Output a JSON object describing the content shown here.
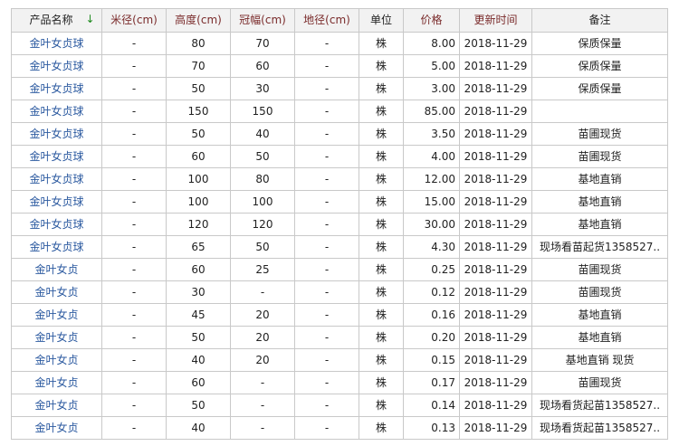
{
  "columns": {
    "name": "产品名称",
    "meter_diameter": "米径(cm)",
    "height": "高度(cm)",
    "crown": "冠幅(cm)",
    "ground_diameter": "地径(cm)",
    "unit": "单位",
    "price": "价格",
    "updated": "更新时间",
    "note": "备注"
  },
  "sort_icon": "down-arrow-icon",
  "rows": [
    {
      "name": "金叶女贞球",
      "meter_diameter": "-",
      "height": "80",
      "crown": "70",
      "ground_diameter": "-",
      "unit": "株",
      "price": "8.00",
      "updated": "2018-11-29",
      "note": "保质保量"
    },
    {
      "name": "金叶女贞球",
      "meter_diameter": "-",
      "height": "70",
      "crown": "60",
      "ground_diameter": "-",
      "unit": "株",
      "price": "5.00",
      "updated": "2018-11-29",
      "note": "保质保量"
    },
    {
      "name": "金叶女贞球",
      "meter_diameter": "-",
      "height": "50",
      "crown": "30",
      "ground_diameter": "-",
      "unit": "株",
      "price": "3.00",
      "updated": "2018-11-29",
      "note": "保质保量"
    },
    {
      "name": "金叶女贞球",
      "meter_diameter": "-",
      "height": "150",
      "crown": "150",
      "ground_diameter": "-",
      "unit": "株",
      "price": "85.00",
      "updated": "2018-11-29",
      "note": ""
    },
    {
      "name": "金叶女贞球",
      "meter_diameter": "-",
      "height": "50",
      "crown": "40",
      "ground_diameter": "-",
      "unit": "株",
      "price": "3.50",
      "updated": "2018-11-29",
      "note": "苗圃现货"
    },
    {
      "name": "金叶女贞球",
      "meter_diameter": "-",
      "height": "60",
      "crown": "50",
      "ground_diameter": "-",
      "unit": "株",
      "price": "4.00",
      "updated": "2018-11-29",
      "note": "苗圃现货"
    },
    {
      "name": "金叶女贞球",
      "meter_diameter": "-",
      "height": "100",
      "crown": "80",
      "ground_diameter": "-",
      "unit": "株",
      "price": "12.00",
      "updated": "2018-11-29",
      "note": "基地直销"
    },
    {
      "name": "金叶女贞球",
      "meter_diameter": "-",
      "height": "100",
      "crown": "100",
      "ground_diameter": "-",
      "unit": "株",
      "price": "15.00",
      "updated": "2018-11-29",
      "note": "基地直销"
    },
    {
      "name": "金叶女贞球",
      "meter_diameter": "-",
      "height": "120",
      "crown": "120",
      "ground_diameter": "-",
      "unit": "株",
      "price": "30.00",
      "updated": "2018-11-29",
      "note": "基地直销"
    },
    {
      "name": "金叶女贞球",
      "meter_diameter": "-",
      "height": "65",
      "crown": "50",
      "ground_diameter": "-",
      "unit": "株",
      "price": "4.30",
      "updated": "2018-11-29",
      "note": "现场看苗起货1358527.."
    },
    {
      "name": "金叶女贞",
      "meter_diameter": "-",
      "height": "60",
      "crown": "25",
      "ground_diameter": "-",
      "unit": "株",
      "price": "0.25",
      "updated": "2018-11-29",
      "note": "苗圃现货"
    },
    {
      "name": "金叶女贞",
      "meter_diameter": "-",
      "height": "30",
      "crown": "-",
      "ground_diameter": "-",
      "unit": "株",
      "price": "0.12",
      "updated": "2018-11-29",
      "note": "苗圃现货"
    },
    {
      "name": "金叶女贞",
      "meter_diameter": "-",
      "height": "45",
      "crown": "20",
      "ground_diameter": "-",
      "unit": "株",
      "price": "0.16",
      "updated": "2018-11-29",
      "note": "基地直销"
    },
    {
      "name": "金叶女贞",
      "meter_diameter": "-",
      "height": "50",
      "crown": "20",
      "ground_diameter": "-",
      "unit": "株",
      "price": "0.20",
      "updated": "2018-11-29",
      "note": "基地直销"
    },
    {
      "name": "金叶女贞",
      "meter_diameter": "-",
      "height": "40",
      "crown": "20",
      "ground_diameter": "-",
      "unit": "株",
      "price": "0.15",
      "updated": "2018-11-29",
      "note": "基地直销 现货"
    },
    {
      "name": "金叶女贞",
      "meter_diameter": "-",
      "height": "60",
      "crown": "-",
      "ground_diameter": "-",
      "unit": "株",
      "price": "0.17",
      "updated": "2018-11-29",
      "note": "苗圃现货"
    },
    {
      "name": "金叶女贞",
      "meter_diameter": "-",
      "height": "50",
      "crown": "-",
      "ground_diameter": "-",
      "unit": "株",
      "price": "0.14",
      "updated": "2018-11-29",
      "note": "现场看货起苗1358527.."
    },
    {
      "name": "金叶女贞",
      "meter_diameter": "-",
      "height": "40",
      "crown": "-",
      "ground_diameter": "-",
      "unit": "株",
      "price": "0.13",
      "updated": "2018-11-29",
      "note": "现场看货起苗1358527.."
    }
  ]
}
